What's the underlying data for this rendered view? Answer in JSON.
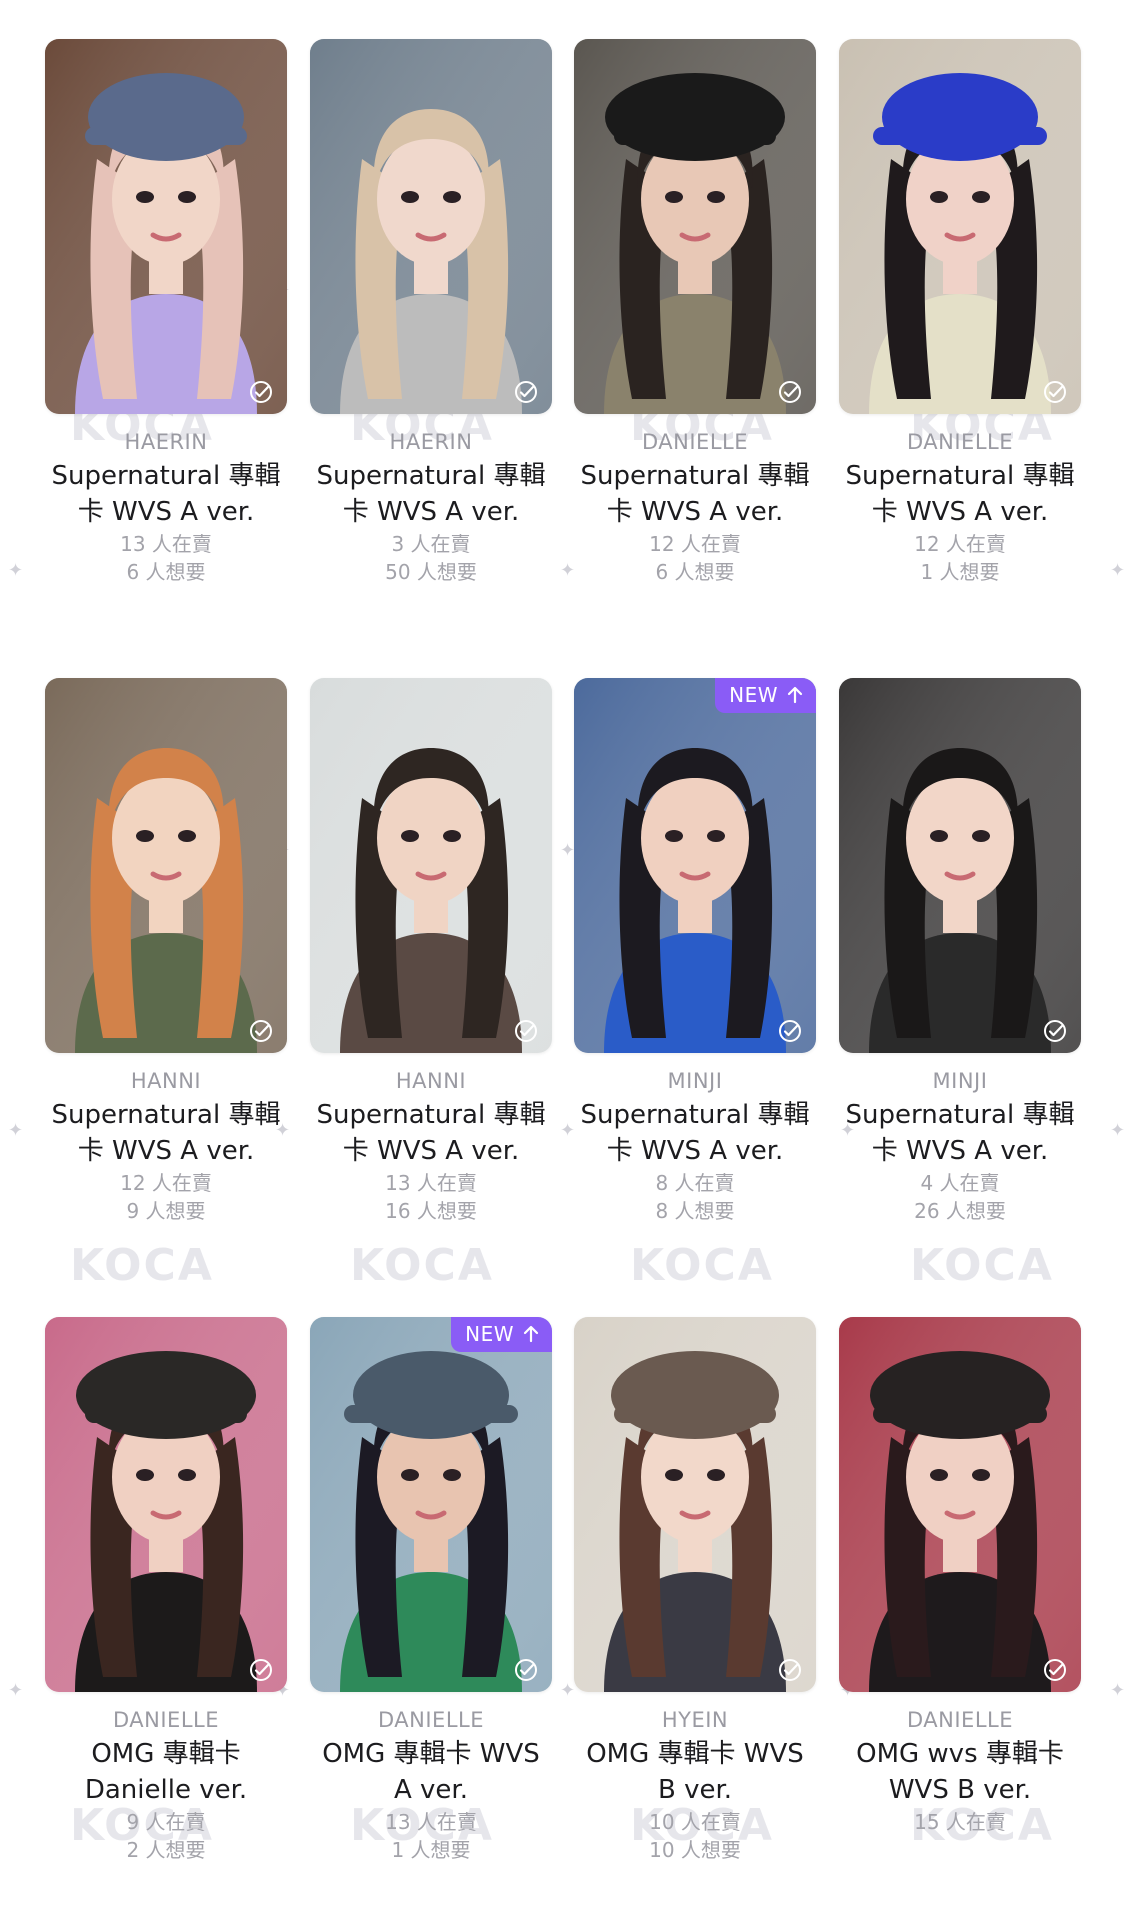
{
  "watermark": "KOCA",
  "check_icon": "check-circle-icon",
  "badge_icon": "arrow-up-icon",
  "accent": "#8a5cf6",
  "cards": [
    {
      "member": "HAERIN",
      "title": "Supernatural 專輯卡 WVS A ver.",
      "selling": "13 人在賣",
      "wanting": "6 人想要",
      "badge": "",
      "photo": {
        "bg": "#6b4a3a",
        "hair": "#e6c2b8",
        "skin": "#f1d6c8",
        "top": "#b8a6e6",
        "hat": "#5a6a8c"
      }
    },
    {
      "member": "HAERIN",
      "title": "Supernatural 專輯卡 WVS A ver.",
      "selling": "3 人在賣",
      "wanting": "50 人想要",
      "badge": "",
      "photo": {
        "bg": "#6f7e8c",
        "hair": "#d8c2a8",
        "skin": "#f0d8cc",
        "top": "#bcbcbc",
        "hat": ""
      }
    },
    {
      "member": "DANIELLE",
      "title": "Supernatural 專輯卡 WVS A ver.",
      "selling": "12 人在賣",
      "wanting": "6 人想要",
      "badge": "",
      "photo": {
        "bg": "#5a5650",
        "hair": "#2a2320",
        "skin": "#e8c8b6",
        "top": "#8a826c",
        "hat": "#1a1a1a"
      }
    },
    {
      "member": "DANIELLE",
      "title": "Supernatural 專輯卡 WVS A ver.",
      "selling": "12 人在賣",
      "wanting": "1 人想要",
      "badge": "",
      "photo": {
        "bg": "#c9c0b2",
        "hair": "#1f1a1c",
        "skin": "#f0d2c8",
        "top": "#e4e0c8",
        "hat": "#2a3cc8"
      }
    },
    {
      "member": "HANNI",
      "title": "Supernatural 專輯卡 WVS A ver.",
      "selling": "12 人在賣",
      "wanting": "9 人想要",
      "badge": "",
      "photo": {
        "bg": "#7a6a5a",
        "hair": "#d2824a",
        "skin": "#f2d4c0",
        "top": "#5c6a4c",
        "hat": ""
      }
    },
    {
      "member": "HANNI",
      "title": "Supernatural 專輯卡 WVS A ver.",
      "selling": "13 人在賣",
      "wanting": "16 人想要",
      "badge": "",
      "photo": {
        "bg": "#d8dcdc",
        "hair": "#2e2622",
        "skin": "#f0d4c4",
        "top": "#5a4a44",
        "hat": ""
      }
    },
    {
      "member": "MINJI",
      "title": "Supernatural 專輯卡 WVS A ver.",
      "selling": "8 人在賣",
      "wanting": "8 人想要",
      "badge": "NEW",
      "photo": {
        "bg": "#4c6a9c",
        "hair": "#1c1a20",
        "skin": "#f0d0c0",
        "top": "#2a5cc8",
        "hat": ""
      }
    },
    {
      "member": "MINJI",
      "title": "Supernatural 專輯卡 WVS A ver.",
      "selling": "4 人在賣",
      "wanting": "26 人想要",
      "badge": "",
      "photo": {
        "bg": "#3a3838",
        "hair": "#1a1818",
        "skin": "#f2d6c8",
        "top": "#2a2a2a",
        "hat": ""
      }
    },
    {
      "member": "DANIELLE",
      "title": "OMG 專輯卡 Danielle ver.",
      "selling": "9 人在賣",
      "wanting": "2 人想要",
      "badge": "",
      "photo": {
        "bg": "#c86a8a",
        "hair": "#3a2620",
        "skin": "#f0d0c2",
        "top": "#1c1a1a",
        "hat": "#2a2826"
      }
    },
    {
      "member": "DANIELLE",
      "title": "OMG 專輯卡 WVS A ver.",
      "selling": "13 人在賣",
      "wanting": "1 人想要",
      "badge": "NEW",
      "photo": {
        "bg": "#8aa6b8",
        "hair": "#1c1a24",
        "skin": "#e8c4b0",
        "top": "#2e8a5a",
        "hat": "#4a5a6a"
      }
    },
    {
      "member": "HYEIN",
      "title": "OMG 專輯卡 WVS B ver.",
      "selling": "10 人在賣",
      "wanting": "10 人想要",
      "badge": "",
      "photo": {
        "bg": "#d8d2c8",
        "hair": "#5a3a30",
        "skin": "#f2d8ca",
        "top": "#3a3a44",
        "hat": "#6a5a50"
      }
    },
    {
      "member": "DANIELLE",
      "title": "OMG wvs 專輯卡 WVS B ver.",
      "selling": "15 人在賣",
      "wanting": "",
      "badge": "",
      "photo": {
        "bg": "#a83a4a",
        "hair": "#2a1a1c",
        "skin": "#f0d0c4",
        "top": "#1e1a1c",
        "hat": "#262222"
      }
    }
  ]
}
